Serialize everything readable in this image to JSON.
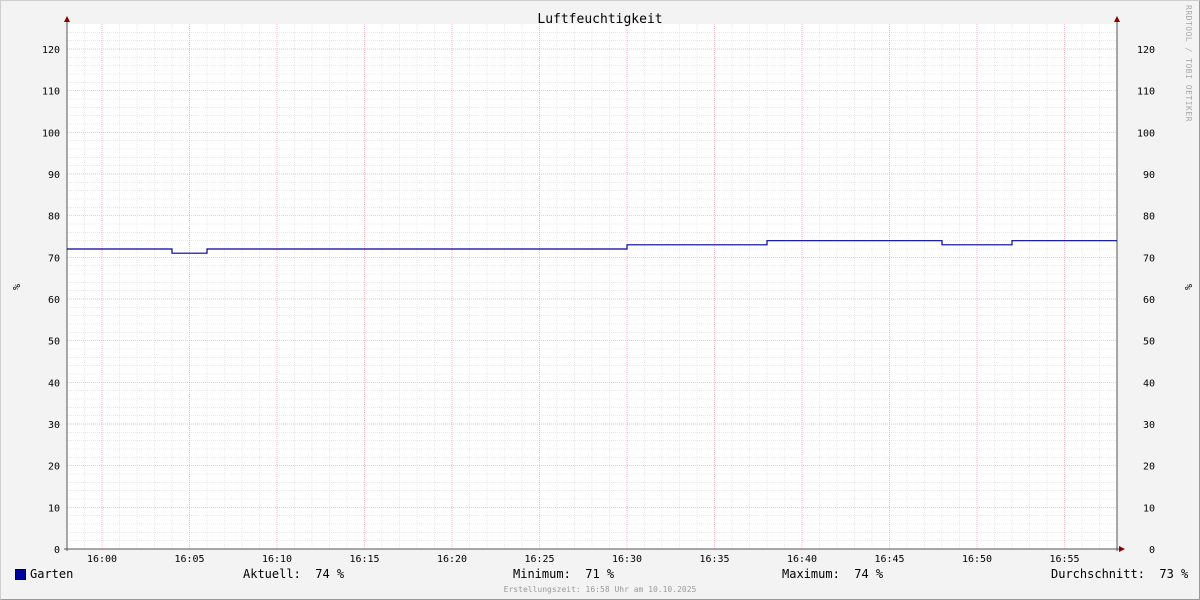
{
  "chart_data": {
    "type": "line",
    "title": "Luftfeuchtigkeit",
    "ylabel": "%",
    "ylabel_right": "%",
    "ylim": [
      0,
      126
    ],
    "yticks": [
      0,
      10,
      20,
      30,
      40,
      50,
      60,
      70,
      80,
      90,
      100,
      110,
      120
    ],
    "xlim": [
      "15:58",
      "16:58"
    ],
    "xticks": [
      "16:00",
      "16:05",
      "16:10",
      "16:15",
      "16:20",
      "16:25",
      "16:30",
      "16:35",
      "16:40",
      "16:45",
      "16:50",
      "16:55"
    ],
    "grid": true,
    "series": [
      {
        "name": "Garten",
        "color": "#00009c",
        "step": true,
        "points": [
          {
            "x": "15:58",
            "y": 72
          },
          {
            "x": "16:04",
            "y": 71
          },
          {
            "x": "16:06",
            "y": 72
          },
          {
            "x": "16:30",
            "y": 73
          },
          {
            "x": "16:38",
            "y": 74
          },
          {
            "x": "16:48",
            "y": 73
          },
          {
            "x": "16:52",
            "y": 74
          },
          {
            "x": "16:58",
            "y": 74
          }
        ]
      }
    ]
  },
  "legend": {
    "series_name": "Garten",
    "current_label": "Aktuell:",
    "current_value": "74 %",
    "min_label": "Minimum:",
    "min_value": "71 %",
    "max_label": "Maximum:",
    "max_value": "74 %",
    "avg_label": "Durchschnitt:",
    "avg_value": "73 %"
  },
  "footer": "Erstellungszeit: 16:58 Uhr am 10.10.2025",
  "watermark": "RRDTOOL / TOBI OETIKER"
}
